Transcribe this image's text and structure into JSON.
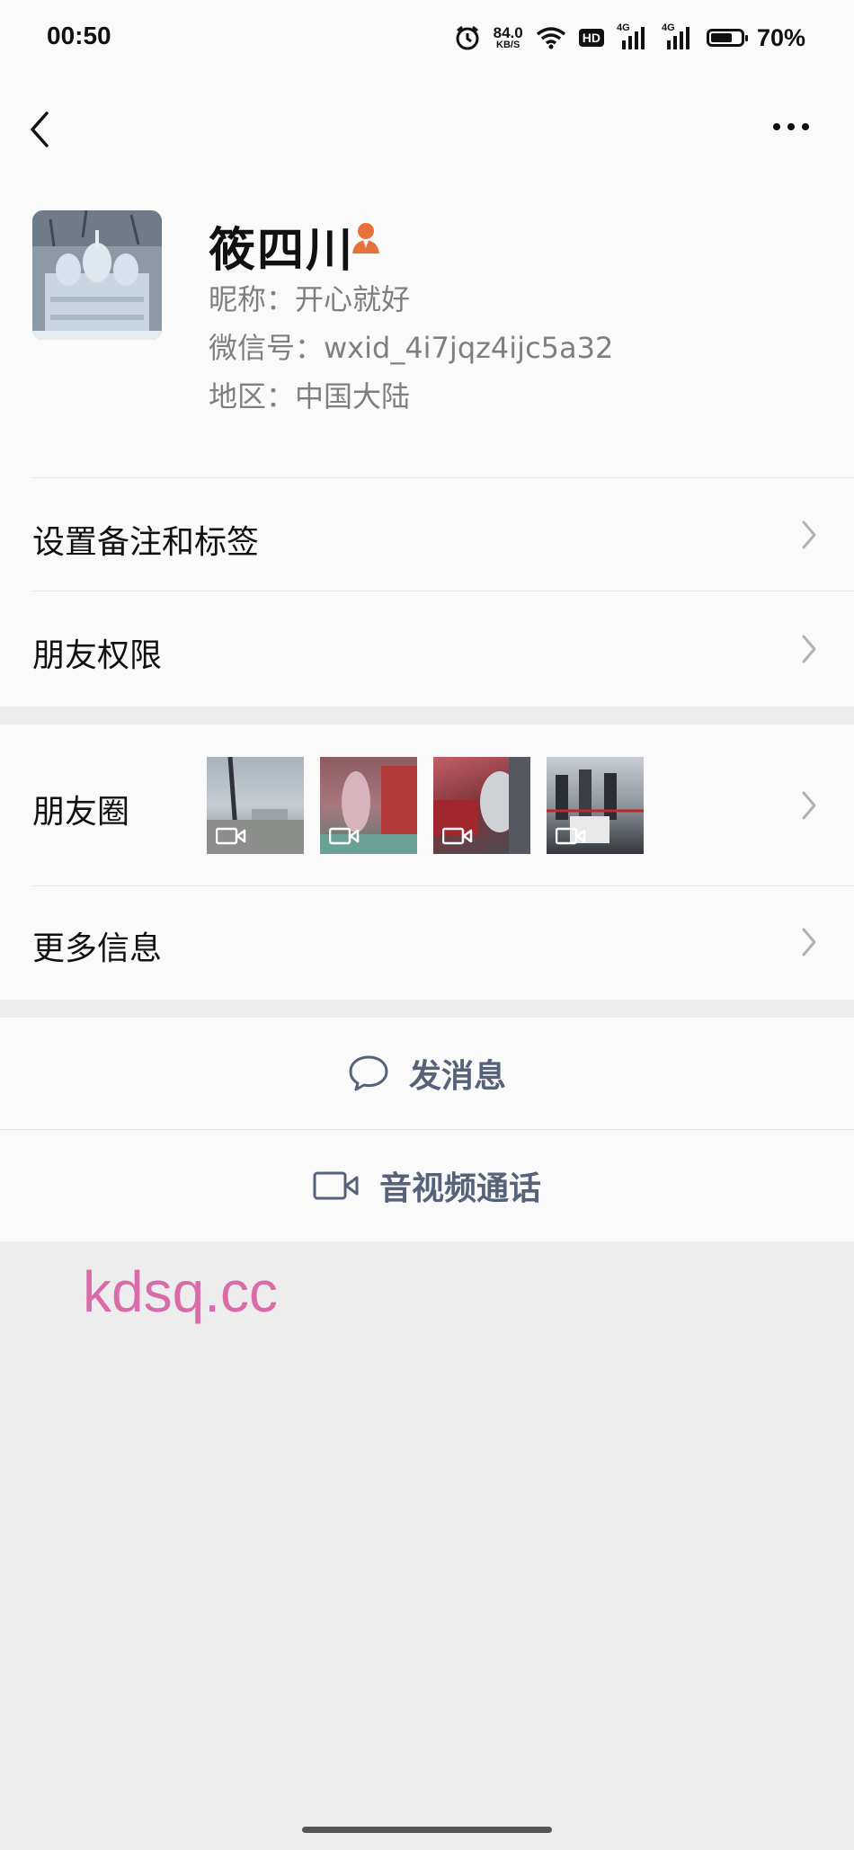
{
  "status_bar": {
    "time": "00:50",
    "net_speed": "84.0",
    "net_unit": "KB/S",
    "hd": "HD",
    "signal_1": "4G",
    "signal_2": "4G",
    "battery": "70%"
  },
  "profile": {
    "name": "筱四川",
    "nickname": "昵称：开心就好",
    "wechat_id": "微信号：wxid_4i7jqz4ijc5a32",
    "region": "地区：中国大陆"
  },
  "rows": {
    "remark_tags": "设置备注和标签",
    "friend_permissions": "朋友权限",
    "moments": "朋友圈",
    "more_info": "更多信息"
  },
  "actions": {
    "send_message": "发消息",
    "video_call": "音视频通话"
  },
  "watermark": "kdsq.cc",
  "colors": {
    "action_text": "#56627a",
    "icon_orange": "#e8703a",
    "background": "#ededed"
  }
}
